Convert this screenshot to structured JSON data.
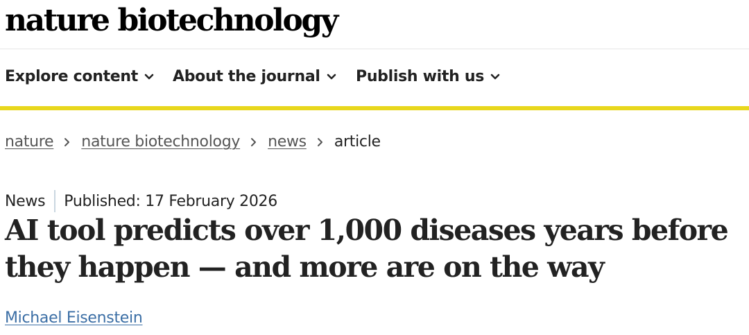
{
  "header": {
    "logo_text": "nature biotechnology"
  },
  "nav": {
    "items": [
      {
        "label": "Explore content"
      },
      {
        "label": "About the journal"
      },
      {
        "label": "Publish with us"
      }
    ],
    "chevron_icon": "chevron-down-icon"
  },
  "colors": {
    "accent_bar": "#e8d71d",
    "link": "#3b6ea5",
    "text": "#222222",
    "muted_link": "#555555"
  },
  "breadcrumb": {
    "items": [
      {
        "label": "nature",
        "link": true
      },
      {
        "label": "nature biotechnology",
        "link": true
      },
      {
        "label": "news",
        "link": true
      },
      {
        "label": "article",
        "link": false
      }
    ],
    "separator_icon": "chevron-right-icon"
  },
  "article": {
    "type": "News",
    "published": "Published: 17 February 2026",
    "title": "AI tool predicts over 1,000 diseases years before they happen — and more are on the way",
    "author": "Michael Eisenstein"
  }
}
